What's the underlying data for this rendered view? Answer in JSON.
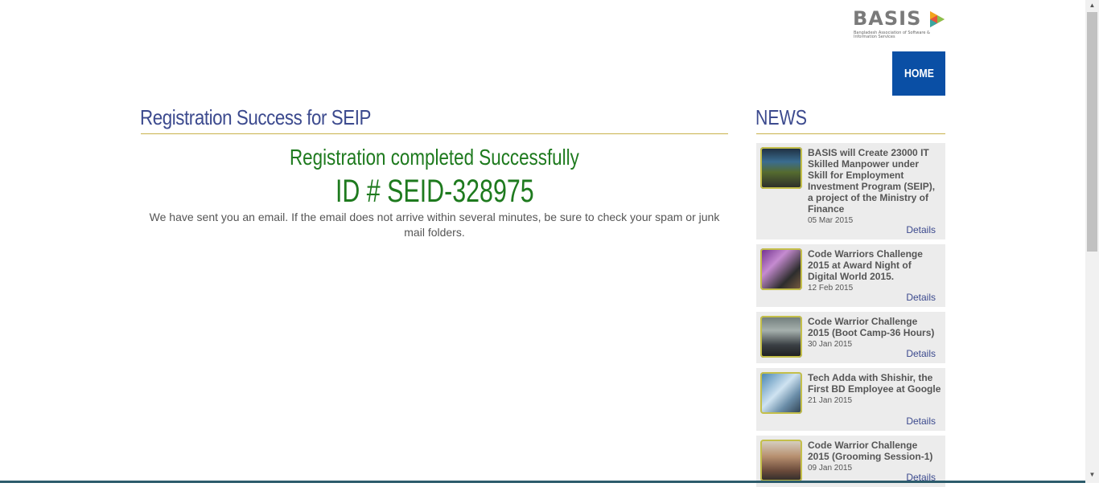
{
  "brand": {
    "logo_word": "BASIS",
    "logo_subtitle": "Bangladesh Association of Software & Information Services"
  },
  "nav": {
    "home_label": "HOME"
  },
  "main": {
    "title": "Registration Success for SEIP",
    "success_message": "Registration completed Successfully",
    "id_text": "ID # SEID-328975",
    "email_note": "We have sent you an email. If the email does not arrive within several minutes, be sure to check your spam or junk mail folders."
  },
  "news": {
    "title": "NEWS",
    "items": [
      {
        "headline": "BASIS will Create 23000 IT Skilled Manpower under Skill for Employment Investment Program (SEIP), a project of the Ministry of Finance",
        "date": "05 Mar 2015",
        "details_label": "Details"
      },
      {
        "headline": "Code Warriors Challenge 2015 at Award Night of Digital World 2015.",
        "date": "12 Feb 2015",
        "details_label": "Details"
      },
      {
        "headline": "Code Warrior Challenge 2015 (Boot Camp-36 Hours)",
        "date": "30 Jan 2015",
        "details_label": "Details"
      },
      {
        "headline": "Tech Adda with Shishir, the First BD Employee at Google",
        "date": "21 Jan 2015",
        "details_label": "Details"
      },
      {
        "headline": "Code Warrior Challenge 2015 (Grooming Session-1)",
        "date": "09 Jan 2015",
        "details_label": "Details"
      }
    ]
  },
  "colors": {
    "heading_blue": "#3c4a8e",
    "success_green": "#1e7a1e",
    "home_button_bg": "#0a4fa5",
    "rule_gold": "#c9b24c",
    "card_bg": "#ececec"
  }
}
